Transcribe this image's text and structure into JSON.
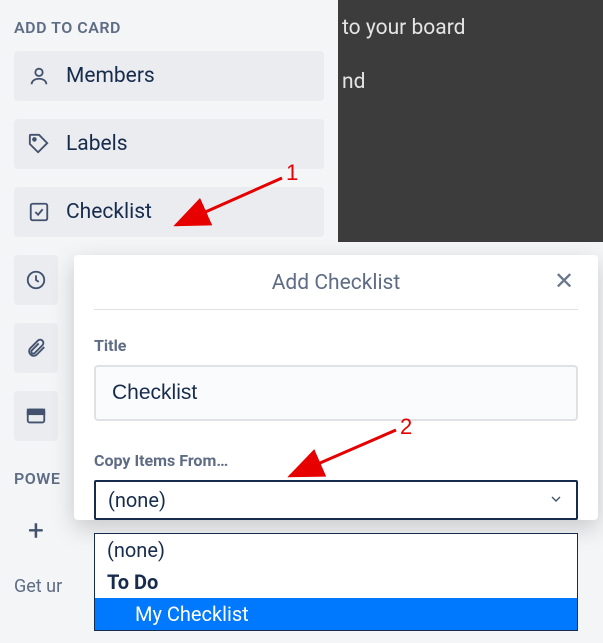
{
  "sidebar": {
    "header": "ADD TO CARD",
    "items": [
      {
        "label": "Members"
      },
      {
        "label": "Labels"
      },
      {
        "label": "Checklist"
      }
    ],
    "powerups_header": "POWE",
    "bottom_text": "Get ur"
  },
  "dark_region": {
    "line1": "to your board",
    "line2": "nd"
  },
  "popover": {
    "title": "Add Checklist",
    "title_label": "Title",
    "title_value": "Checklist",
    "copy_label": "Copy Items From…",
    "select_value": "(none)",
    "options": {
      "none": "(none)",
      "todo": "To Do",
      "mychecklist": "My Checklist"
    }
  },
  "annotations": {
    "n1": "1",
    "n2": "2"
  }
}
